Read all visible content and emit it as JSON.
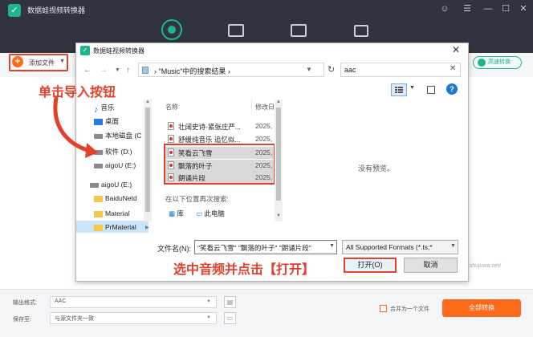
{
  "app": {
    "title": "数据蛙视频转换器",
    "window_controls": [
      "☺",
      "☰",
      "—",
      "☐",
      "✕"
    ],
    "add_file": "添加文件",
    "high_speed": "高速转换",
    "output_format_label": "输出格式:",
    "output_format_value": "AAC",
    "save_to_label": "保存至:",
    "save_to_value": "与源文件夹一致",
    "merge_label": "合并为一个文件",
    "convert_all": "全部转换",
    "watermark": "www.shujuwa.net/"
  },
  "dialog": {
    "title": "数据蛙视频转换器",
    "breadcrumb_sep": "›",
    "address": "\"Music\"中的搜索结果",
    "search_value": "aac",
    "tree": [
      {
        "label": "音乐"
      },
      {
        "label": "桌面"
      },
      {
        "label": "本地磁盘 (C"
      },
      {
        "label": "软件 (D:)"
      },
      {
        "label": "aigoU (E:)"
      },
      {
        "label": "aigoU (E:)"
      },
      {
        "label": "BaiduNetd"
      },
      {
        "label": "Material"
      },
      {
        "label": "PrMaterial"
      }
    ],
    "columns": {
      "name": "名称",
      "modified": "修改日"
    },
    "files": [
      {
        "name": "壮阔史诗-紧张庄严...",
        "date": "2025,"
      },
      {
        "name": "舒缓纯音乐 追忆似...",
        "date": "2025,"
      },
      {
        "name": "笑看云飞雪",
        "date": "2025,"
      },
      {
        "name": "飘落的叶子",
        "date": "2025,"
      },
      {
        "name": "朗诵片段",
        "date": "2025,"
      }
    ],
    "search_again": "在以下位置再次搜索:",
    "search_again_items": [
      "库",
      "此电脑"
    ],
    "no_preview": "没有预览。",
    "filename_label": "文件名(N):",
    "filename_value": "\"笑看云飞雪\" \"飘落的叶子\" \"朗诵片段\"",
    "format_value": "All Supported Formats (*.ts;*",
    "open": "打开(O)",
    "cancel": "取消"
  },
  "annotations": {
    "click_import": "单击导入按钮",
    "select_and_open": "选中音频并点击【打开】"
  },
  "colors": {
    "accent": "#1fb489",
    "orange": "#ff6a1a",
    "annotation_red": "#e2412c"
  }
}
